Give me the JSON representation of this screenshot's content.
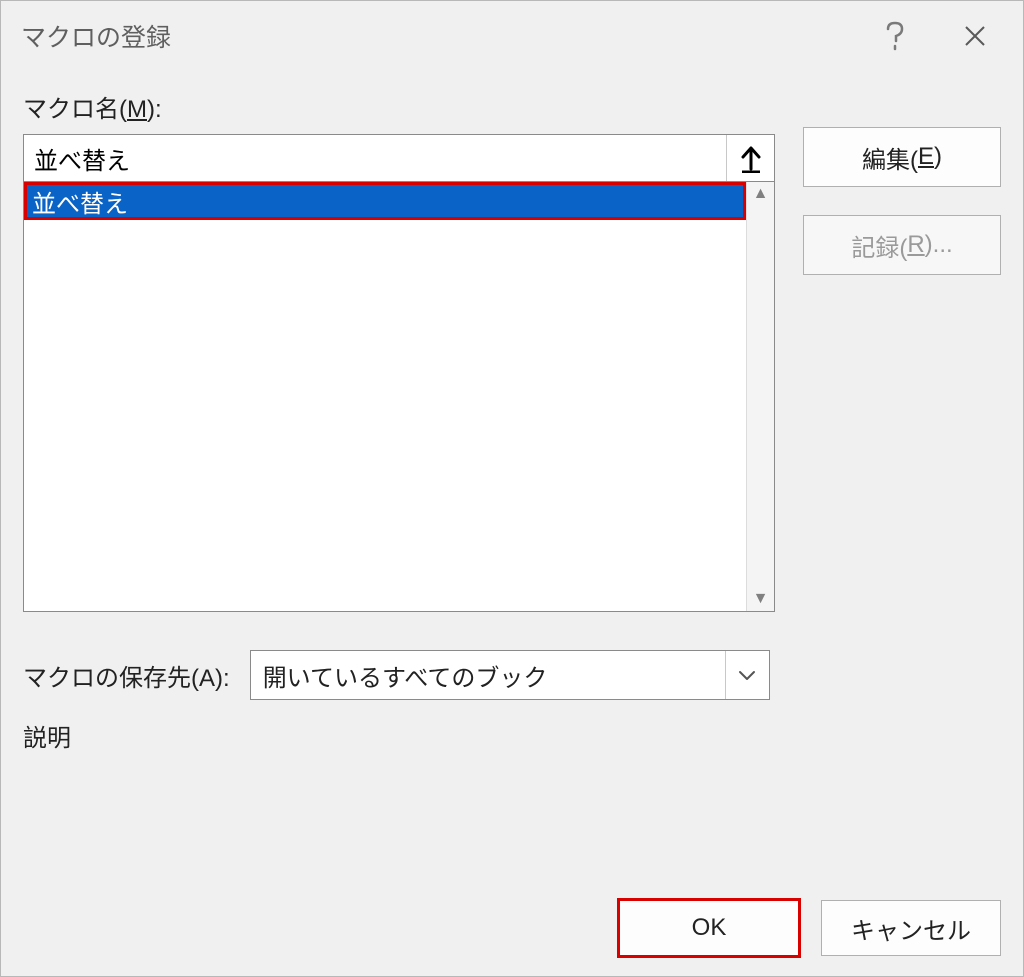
{
  "dialog": {
    "title": "マクロの登録"
  },
  "macro_name": {
    "label_prefix": "マクロ名(",
    "label_hotkey": "M",
    "label_suffix": "):",
    "value": "並べ替え"
  },
  "macro_list": {
    "items": [
      {
        "label": "並べ替え",
        "selected": true
      }
    ]
  },
  "side_buttons": {
    "edit_prefix": "編集(",
    "edit_hotkey": "E",
    "edit_suffix": ")",
    "record_prefix": "記録(",
    "record_hotkey": "R",
    "record_suffix": ")..."
  },
  "save_in": {
    "label_prefix": "マクロの保存先(",
    "label_hotkey": "A",
    "label_suffix": "):",
    "value": "開いているすべてのブック"
  },
  "description": {
    "label": "説明"
  },
  "footer": {
    "ok": "OK",
    "cancel": "キャンセル"
  }
}
